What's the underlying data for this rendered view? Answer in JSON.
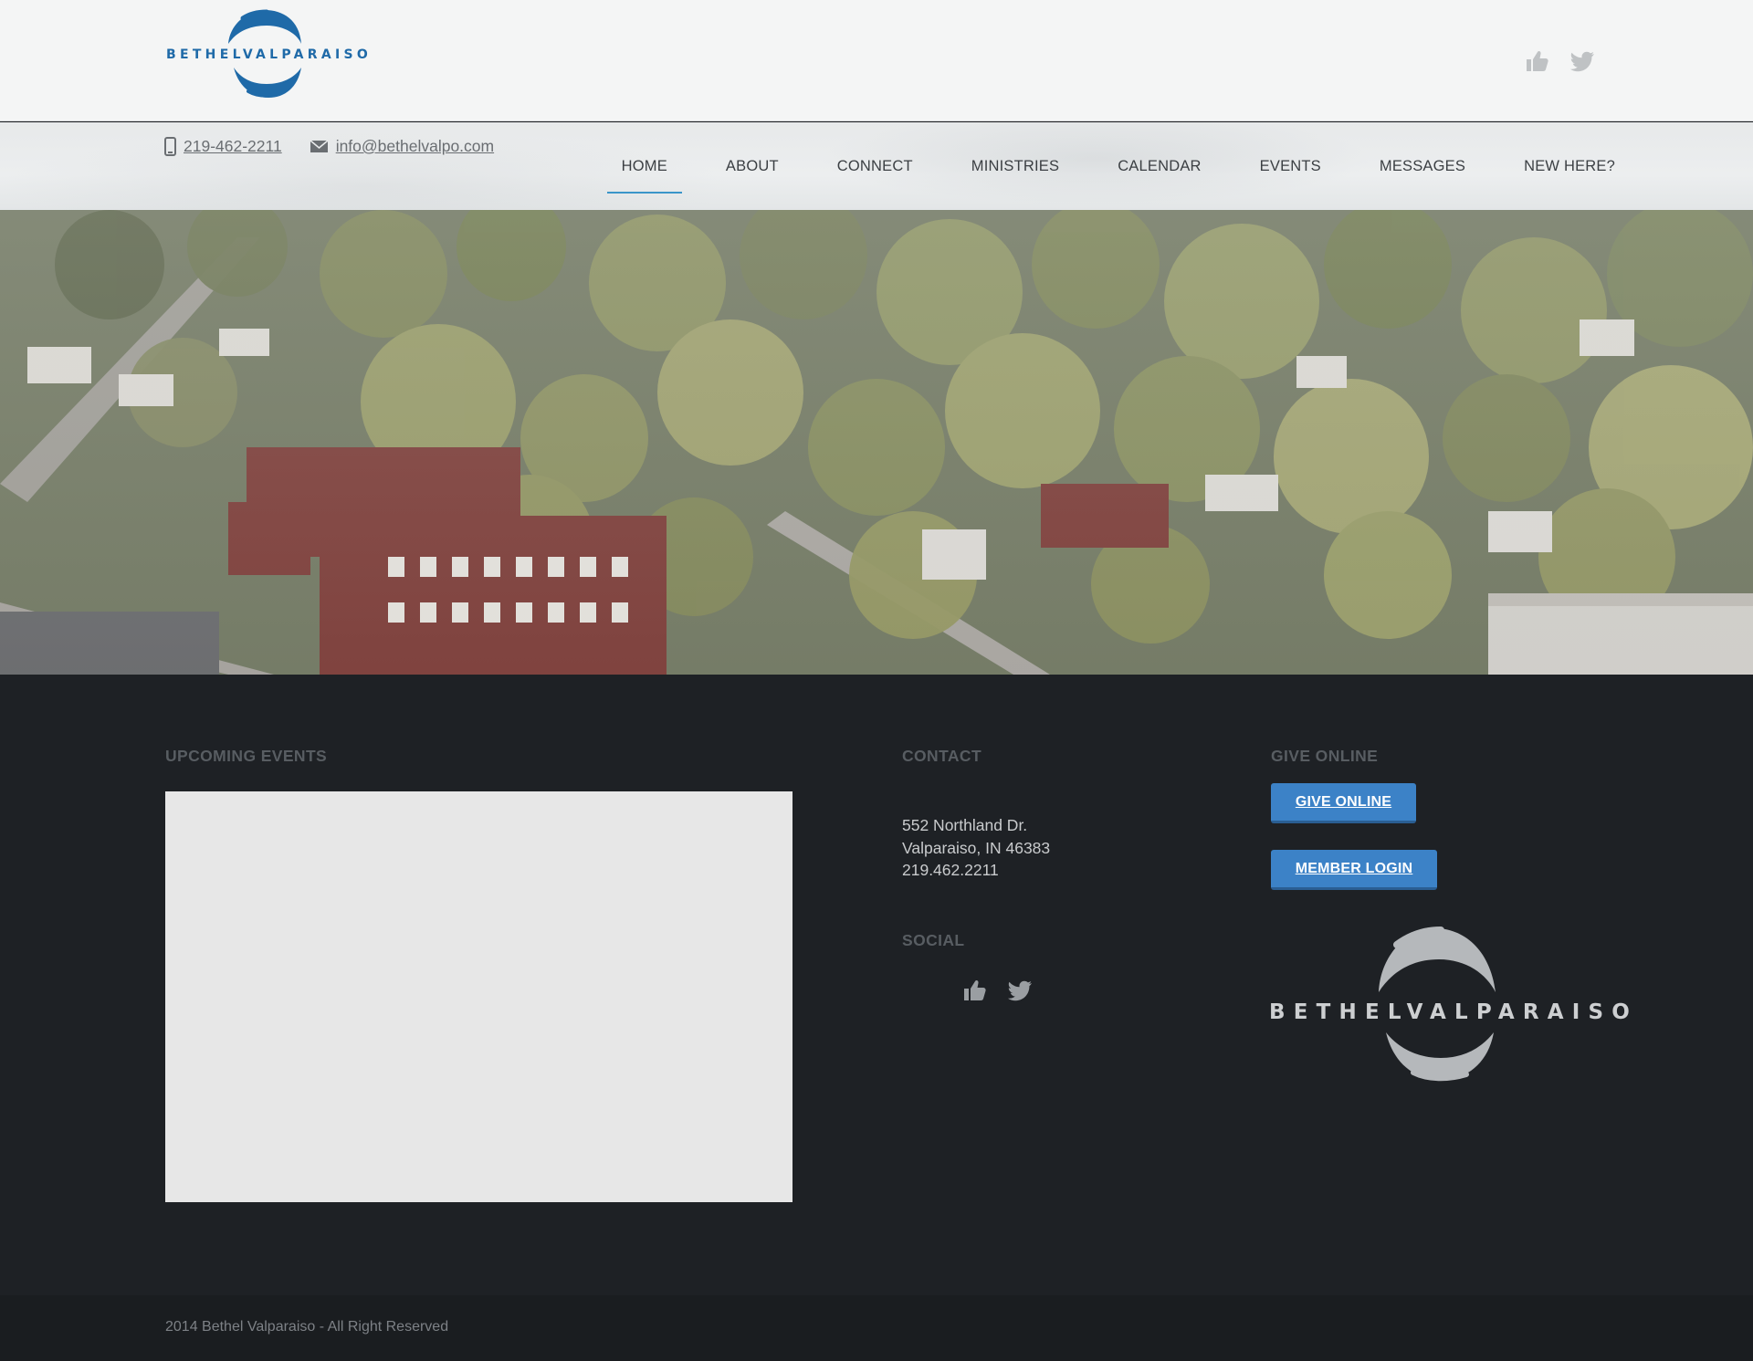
{
  "header": {
    "logo_text": "BETHELVALPARAISO",
    "social": [
      "like-icon",
      "twitter-icon"
    ]
  },
  "contact_bar": {
    "phone": "219-462-2211",
    "email": "info@bethelvalpo.com"
  },
  "nav": {
    "items": [
      {
        "label": "HOME",
        "active": true
      },
      {
        "label": "ABOUT"
      },
      {
        "label": "CONNECT"
      },
      {
        "label": "MINISTRIES"
      },
      {
        "label": "CALENDAR"
      },
      {
        "label": "EVENTS"
      },
      {
        "label": "MESSAGES"
      },
      {
        "label": "NEW HERE?"
      }
    ]
  },
  "footer": {
    "upcoming_events": {
      "title": "UPCOMING EVENTS"
    },
    "contact": {
      "title": "CONTACT",
      "address_line1": "552 Northland Dr.",
      "address_line2": "Valparaiso, IN 46383",
      "phone": "219.462.2211"
    },
    "social": {
      "title": "SOCIAL"
    },
    "give": {
      "title": "GIVE ONLINE",
      "give_button": "GIVE ONLINE",
      "login_button": "MEMBER LOGIN"
    },
    "logo_text": "BETHELVALPARAISO",
    "copyright": "2014 Bethel Valparaiso - All Right Reserved"
  },
  "colors": {
    "accent": "#3c82c7",
    "logo_blue": "#1f6aa8",
    "footer_bg": "#1e2125",
    "nav_active_underline": "#3a95c9"
  }
}
